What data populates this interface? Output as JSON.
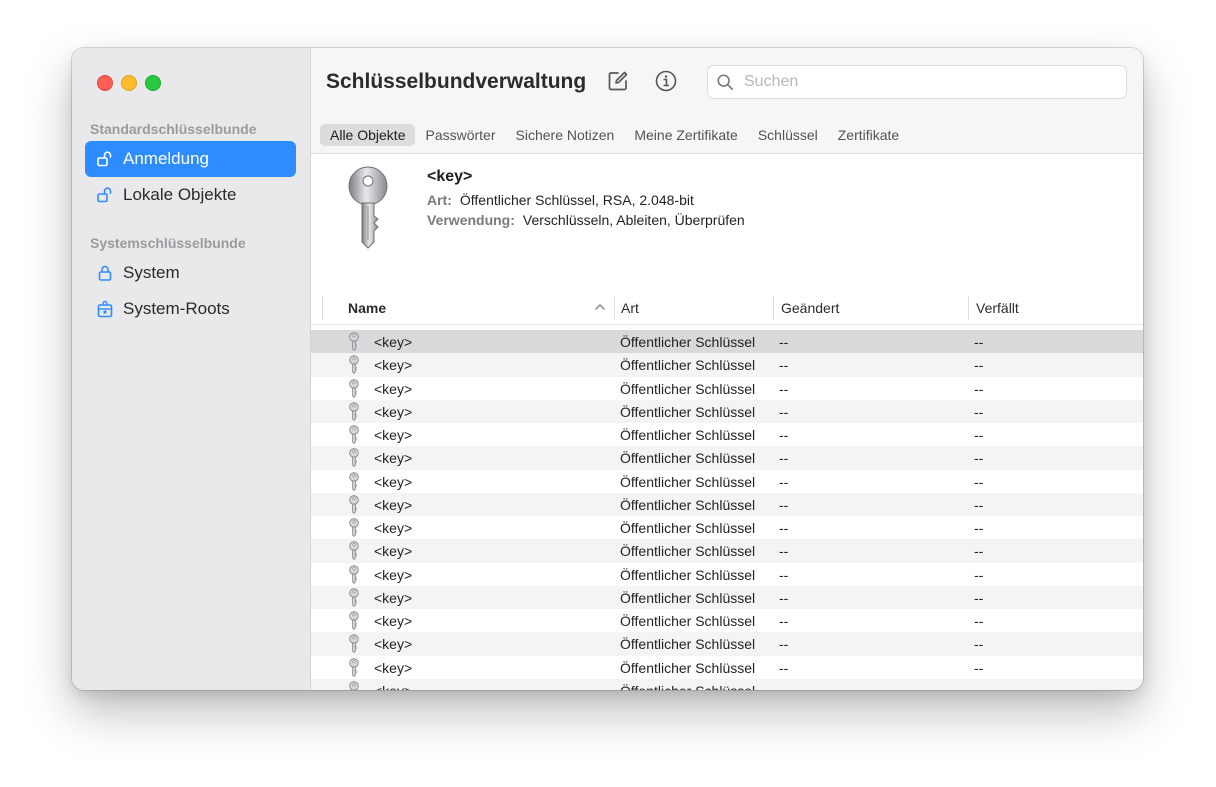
{
  "sidebar": {
    "section_standard": "Standardschlüsselbunde",
    "section_system": "Systemschlüsselbunde",
    "items": [
      {
        "label": "Anmeldung",
        "icon": "unlocked-lock-icon",
        "active": true
      },
      {
        "label": "Lokale Objekte",
        "icon": "unlocked-lock-icon",
        "active": false
      },
      {
        "label": "System",
        "icon": "lock-icon",
        "active": false
      },
      {
        "label": "System-Roots",
        "icon": "cabinet-lock-icon",
        "active": false
      }
    ]
  },
  "toolbar": {
    "title": "Schlüsselbundverwaltung",
    "compose_icon": "compose-icon",
    "info_icon": "info-icon",
    "search_placeholder": "Suchen"
  },
  "tabs": [
    "Alle Objekte",
    "Passwörter",
    "Sichere Notizen",
    "Meine Zertifikate",
    "Schlüssel",
    "Zertifikate"
  ],
  "active_tab": "Alle Objekte",
  "detail": {
    "title": "<key>",
    "art_label": "Art:",
    "art_value": "Öffentlicher Schlüssel, RSA, 2.048-bit",
    "verwendung_label": "Verwendung:",
    "verwendung_value": "Verschlüsseln, Ableiten, Überprüfen"
  },
  "table": {
    "columns": [
      "Name",
      "Art",
      "Geändert",
      "Verfällt"
    ],
    "sort_column": "Name",
    "rows": [
      {
        "name": "<key>",
        "art": "Öffentlicher Schlüssel",
        "geaendert": "--",
        "verfaellt": "--"
      },
      {
        "name": "<key>",
        "art": "Öffentlicher Schlüssel",
        "geaendert": "--",
        "verfaellt": "--"
      },
      {
        "name": "<key>",
        "art": "Öffentlicher Schlüssel",
        "geaendert": "--",
        "verfaellt": "--"
      },
      {
        "name": "<key>",
        "art": "Öffentlicher Schlüssel",
        "geaendert": "--",
        "verfaellt": "--"
      },
      {
        "name": "<key>",
        "art": "Öffentlicher Schlüssel",
        "geaendert": "--",
        "verfaellt": "--"
      },
      {
        "name": "<key>",
        "art": "Öffentlicher Schlüssel",
        "geaendert": "--",
        "verfaellt": "--"
      },
      {
        "name": "<key>",
        "art": "Öffentlicher Schlüssel",
        "geaendert": "--",
        "verfaellt": "--"
      },
      {
        "name": "<key>",
        "art": "Öffentlicher Schlüssel",
        "geaendert": "--",
        "verfaellt": "--"
      },
      {
        "name": "<key>",
        "art": "Öffentlicher Schlüssel",
        "geaendert": "--",
        "verfaellt": "--"
      },
      {
        "name": "<key>",
        "art": "Öffentlicher Schlüssel",
        "geaendert": "--",
        "verfaellt": "--"
      },
      {
        "name": "<key>",
        "art": "Öffentlicher Schlüssel",
        "geaendert": "--",
        "verfaellt": "--"
      },
      {
        "name": "<key>",
        "art": "Öffentlicher Schlüssel",
        "geaendert": "--",
        "verfaellt": "--"
      },
      {
        "name": "<key>",
        "art": "Öffentlicher Schlüssel",
        "geaendert": "--",
        "verfaellt": "--"
      },
      {
        "name": "<key>",
        "art": "Öffentlicher Schlüssel",
        "geaendert": "--",
        "verfaellt": "--"
      },
      {
        "name": "<key>",
        "art": "Öffentlicher Schlüssel",
        "geaendert": "--",
        "verfaellt": "--"
      },
      {
        "name": "<key>",
        "art": "Öffentlicher Schlüssel",
        "geaendert": "--",
        "verfaellt": "--"
      }
    ]
  },
  "colors": {
    "accent": "#2d8cff",
    "sidebar_bg": "#e9e8ea",
    "selected_row": "#d9d8da",
    "close": "#fe5f57",
    "minimize": "#febc2e",
    "zoom": "#28c840"
  }
}
